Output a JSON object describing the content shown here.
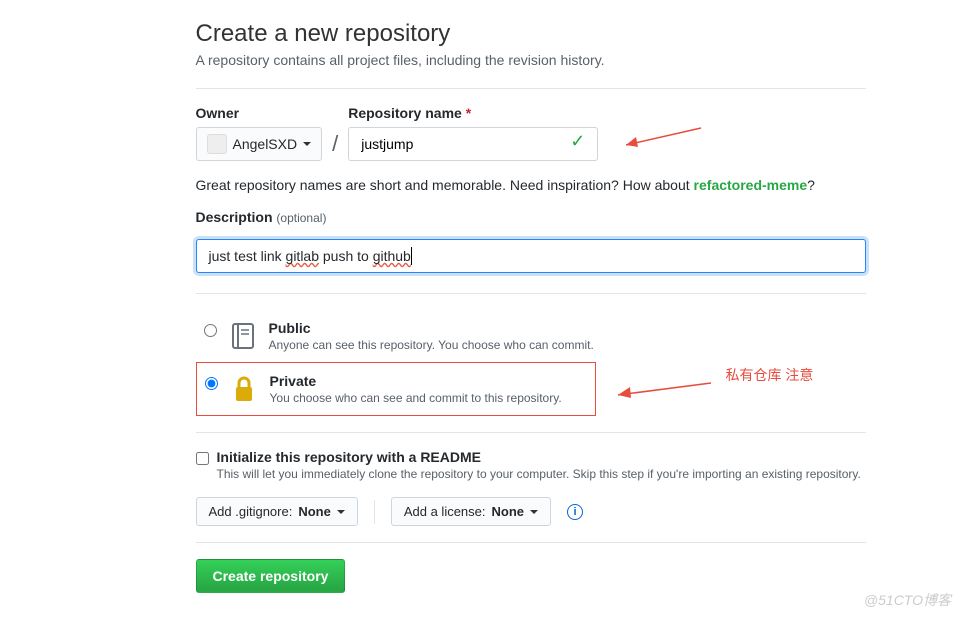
{
  "header": {
    "title": "Create a new repository",
    "subtitle": "A repository contains all project files, including the revision history."
  },
  "owner": {
    "label": "Owner",
    "value": "AngelSXD"
  },
  "repo": {
    "label": "Repository name",
    "required_mark": "*",
    "value": "justjump"
  },
  "hint": {
    "text_pre": "Great repository names are short and memorable. Need inspiration? How about ",
    "suggestion": "refactored-meme",
    "text_post": "?"
  },
  "description": {
    "label": "Description",
    "optional": "(optional)",
    "value_parts": {
      "p1": "just  test  link ",
      "p2": "gitlab",
      "p3": " push to ",
      "p4": "github"
    }
  },
  "visibility": {
    "public": {
      "title": "Public",
      "sub": "Anyone can see this repository. You choose who can commit.",
      "selected": false
    },
    "private": {
      "title": "Private",
      "sub": "You choose who can see and commit to this repository.",
      "selected": true
    }
  },
  "readme": {
    "label": "Initialize this repository with a README",
    "sub": "This will let you immediately clone the repository to your computer. Skip this step if you're importing an existing repository."
  },
  "buttons": {
    "gitignore_pre": "Add .gitignore: ",
    "gitignore_val": "None",
    "license_pre": "Add a license: ",
    "license_val": "None",
    "create": "Create repository"
  },
  "annotations": {
    "private_note": "私有仓库  注意"
  },
  "watermark": "@51CTO博客"
}
